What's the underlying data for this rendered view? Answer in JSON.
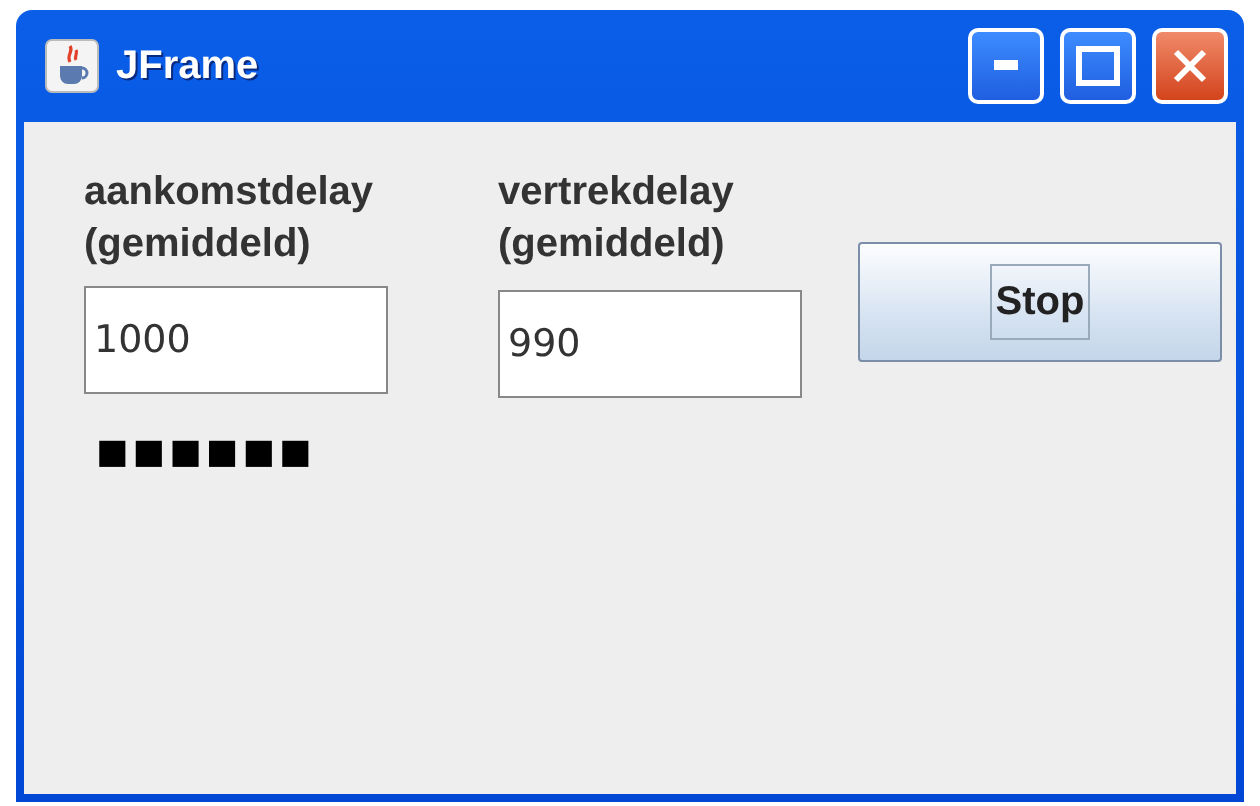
{
  "window": {
    "title": "JFrame"
  },
  "fields": [
    {
      "label": "aankomstdelay (gemiddeld)",
      "value": "1000"
    },
    {
      "label": "vertrekdelay (gemiddeld)",
      "value": "990"
    }
  ],
  "button": {
    "label": "Stop",
    "focused": true
  },
  "queue_marks": "■■■■■■"
}
